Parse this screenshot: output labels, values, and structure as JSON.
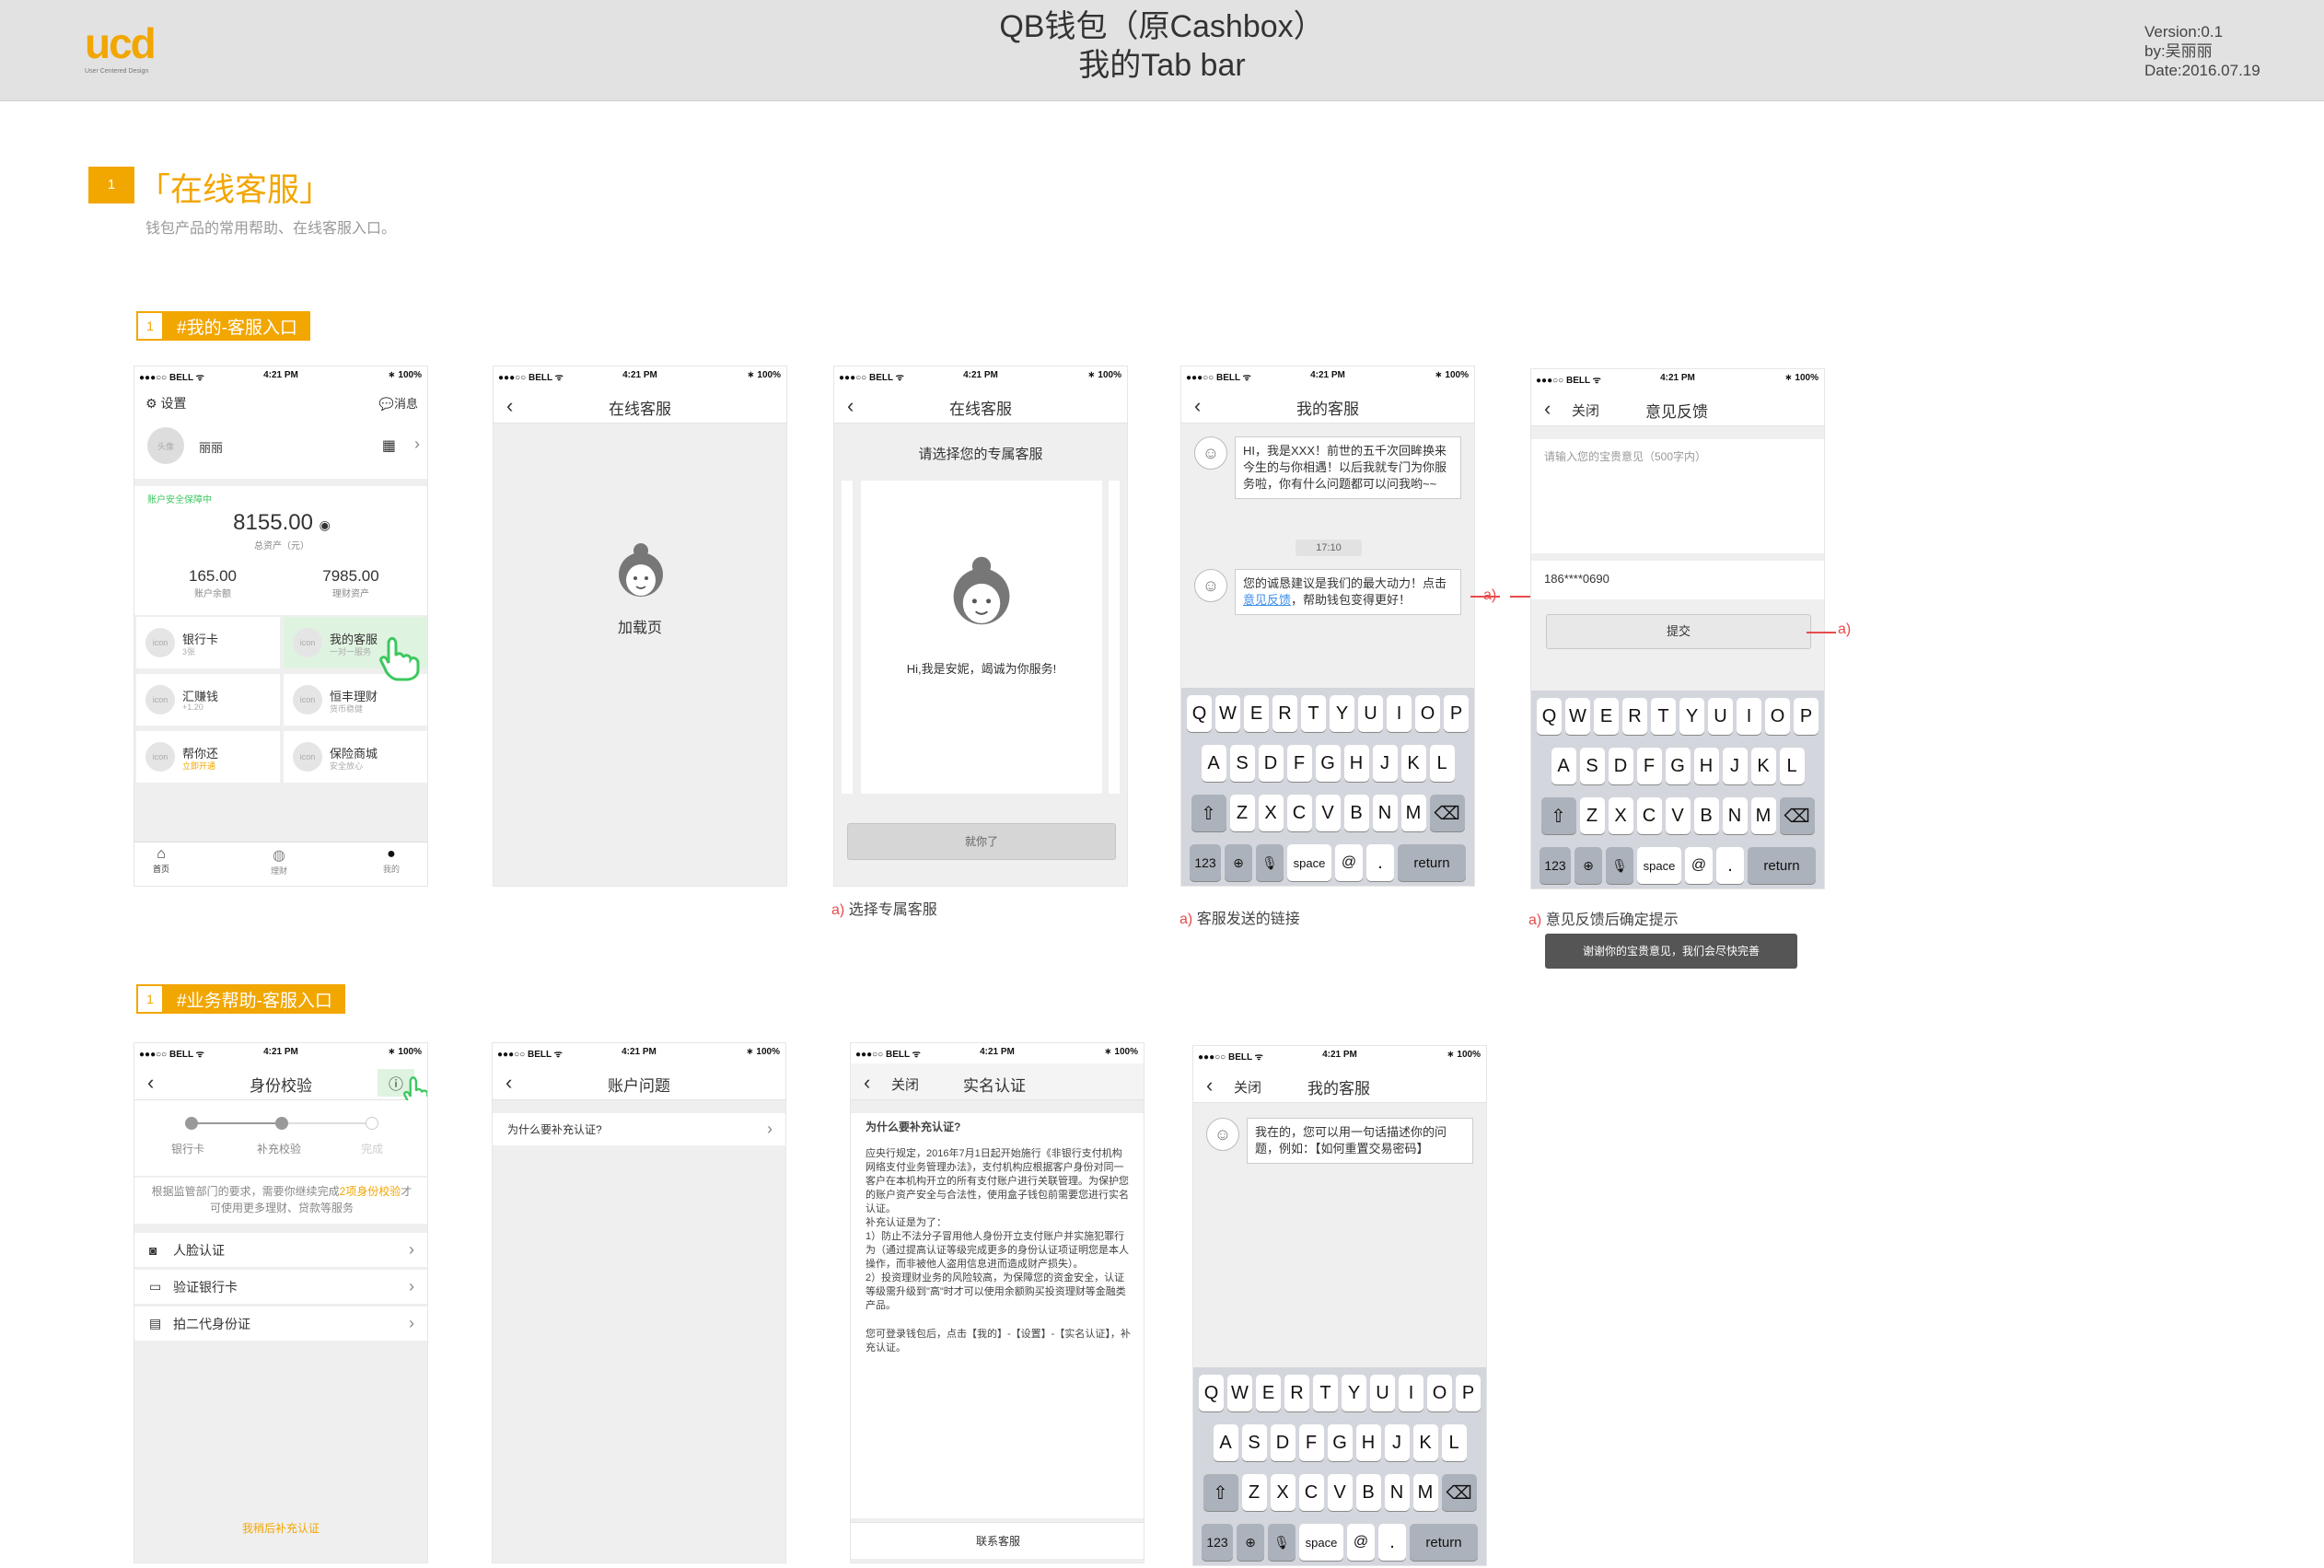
{
  "header": {
    "logo_text": "ucd",
    "logo_sub": "User Centered Design",
    "title_line1": "QB钱包（原Cashbox）",
    "title_line2": "我的Tab bar",
    "version": "Version:0.1",
    "author": "by:吴丽丽",
    "date": "Date:2016.07.19"
  },
  "section": {
    "num": "1",
    "title": "「在线客服」",
    "subtitle": "钱包产品的常用帮助、在线客服入口。"
  },
  "tags": {
    "t1_num": "1",
    "t1": "#我的-客服入口",
    "t2_num": "1",
    "t2": "#业务帮助-客服入口"
  },
  "status_bar": {
    "carrier": "●●●○○ BELL ᯤ",
    "time": "4:21 PM",
    "battery": "∗ 100%"
  },
  "s1": {
    "settings": "设置",
    "messages": "消息",
    "avatar": "头像",
    "name": "丽丽",
    "safe": "账户安全保障中",
    "total": "8155.00",
    "total_label": "总资产（元）",
    "balance": "165.00",
    "balance_label": "账户余额",
    "finance": "7985.00",
    "finance_label": "理财资产",
    "icon_placeholder": "icon",
    "grid": [
      {
        "title": "银行卡",
        "sub": "3张"
      },
      {
        "title": "我的客服",
        "sub": "一对一服务"
      },
      {
        "title": "汇赚钱",
        "sub": "+1.20"
      },
      {
        "title": "恒丰理财",
        "sub": "货币稳健"
      },
      {
        "title": "帮你还",
        "sub": "立即开通"
      },
      {
        "title": "保险商城",
        "sub": "安全放心"
      }
    ],
    "tabs": [
      "首页",
      "理财",
      "我的"
    ]
  },
  "s2": {
    "title": "在线客服",
    "loading": "加载页"
  },
  "s3": {
    "title": "在线客服",
    "prompt": "请选择您的专属客服",
    "greeting": "Hi,我是安妮，竭诚为你服务!",
    "button": "就你了",
    "note_a": "a)",
    "note": "选择专属客服"
  },
  "s4": {
    "title": "我的客服",
    "msg1": "HI，我是XXX！前世的五千次回眸换来今生的与你相遇！以后我就专门为你服务啦，你有什么问题都可以问我哟~~",
    "time": "17:10",
    "msg2_pre": "您的诚恳建议是我们的最大动力！点击",
    "msg2_link": "意见反馈",
    "msg2_post": "，帮助钱包变得更好！",
    "marker": "a)",
    "note_a": "a)",
    "note": "客服发送的链接"
  },
  "s5": {
    "close": "关闭",
    "title": "意见反馈",
    "placeholder": "请输入您的宝贵意见（500字内）",
    "phone": "186****0690",
    "submit": "提交",
    "marker": "a)",
    "note_a": "a)",
    "note": "意见反馈后确定提示",
    "toast": "谢谢你的宝贵意见，我们会尽快完善"
  },
  "keyboard": {
    "row1": [
      "Q",
      "W",
      "E",
      "R",
      "T",
      "Y",
      "U",
      "I",
      "O",
      "P"
    ],
    "row2": [
      "A",
      "S",
      "D",
      "F",
      "G",
      "H",
      "J",
      "K",
      "L"
    ],
    "row3": [
      "Z",
      "X",
      "C",
      "V",
      "B",
      "N",
      "M"
    ],
    "k123": "123",
    "space": "space",
    "at": "@",
    "dot": ".",
    "return": "return"
  },
  "s6": {
    "title": "身份校验",
    "steps": [
      "银行卡",
      "补充校验",
      "完成"
    ],
    "notice_pre": "根据监管部门的要求，需要你继续完成",
    "notice_link": "2项身份校验",
    "notice_post": "才可使用更多理财、贷款等服务",
    "items": [
      "人脸认证",
      "验证银行卡",
      "拍二代身份证"
    ],
    "later": "我稍后补充认证"
  },
  "s7": {
    "title": "账户问题",
    "item": "为什么要补充认证?"
  },
  "s8": {
    "close": "关闭",
    "title": "实名认证",
    "heading": "为什么要补充认证?",
    "body1": "应央行规定，2016年7月1日起开始施行《非银行支付机构网络支付业务管理办法》，支付机构应根据客户身份对同一客户在本机构开立的所有支付账户进行关联管理。为保护您的账户资产安全与合法性，使用盒子钱包前需要您进行实名认证。",
    "body2": "补充认证是为了：",
    "body3": "1）防止不法分子冒用他人身份开立支付账户并实施犯罪行为（通过提高认证等级完成更多的身份认证项证明您是本人操作，而非被他人盗用信息进而造成财产损失）。",
    "body4": "2）投资理财业务的风险较高，为保障您的资金安全，认证等级需升级到\"高\"时才可以使用余额购买投资理财等金融类产品。",
    "body5": "您可登录钱包后，点击【我的】-【设置】-【实名认证】，补充认证。",
    "contact": "联系客服"
  },
  "s9": {
    "close": "关闭",
    "title": "我的客服",
    "msg": "我在的，您可以用一句话描述你的问题，例如：【如何重置交易密码】"
  },
  "colors": {
    "accent": "#f2a600",
    "green": "#3cc85e",
    "red": "#e84b4b",
    "link": "#3b8ee8"
  },
  "icons": [
    "hand-pointer-icon",
    "agent-avatar-icon",
    "gear-icon",
    "message-icon",
    "qrcode-icon",
    "eye-icon",
    "help-icon",
    "face-icon",
    "card-icon",
    "idcard-icon"
  ]
}
